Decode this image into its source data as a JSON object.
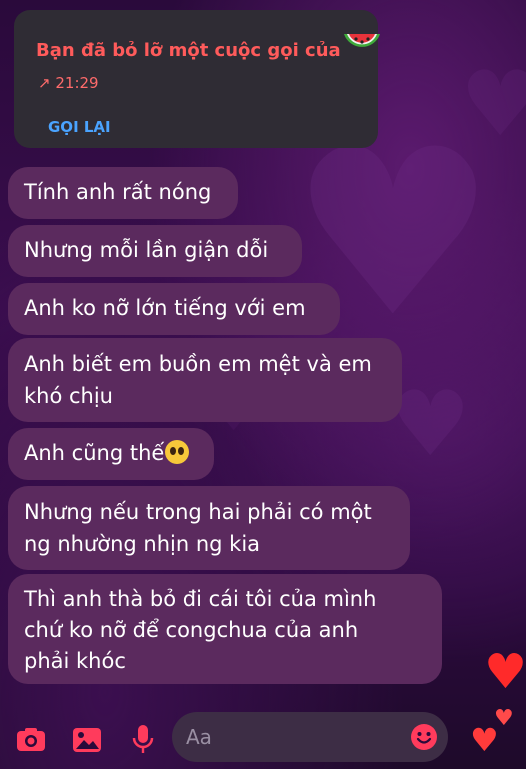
{
  "missed_call": {
    "title": "Bạn đã bỏ lỡ một cuộc gọi của",
    "time": "21:29",
    "callback_label": "GỌI LẠI"
  },
  "messages": [
    {
      "text": "Tính anh rất nóng"
    },
    {
      "text": "Nhưng mỗi lần giận dỗi"
    },
    {
      "text": "Anh ko nỡ lớn tiếng với em"
    },
    {
      "line1": "Anh biết em buồn em mệt và em",
      "line2": "khó chịu"
    },
    {
      "text": "Anh cũng thế"
    },
    {
      "line1": "Nhưng nếu trong hai phải có một",
      "line2": "ng nhường nhịn ng kia"
    },
    {
      "line1": "Thì anh thà bỏ đi cái tôi của mình",
      "line2": "chứ ko nỡ để congchua của anh",
      "line3": "phải khóc"
    }
  ],
  "composer": {
    "placeholder": "Aa"
  },
  "colors": {
    "accent": "#ff3b5c",
    "missed_call": "#ff5b5b",
    "link": "#4aa3ff",
    "bubble": "#5b2a5e"
  },
  "icons": [
    "camera-icon",
    "image-icon",
    "microphone-icon",
    "emoji-icon",
    "heart-icon",
    "watermelon-icon",
    "pleading-face-icon"
  ]
}
